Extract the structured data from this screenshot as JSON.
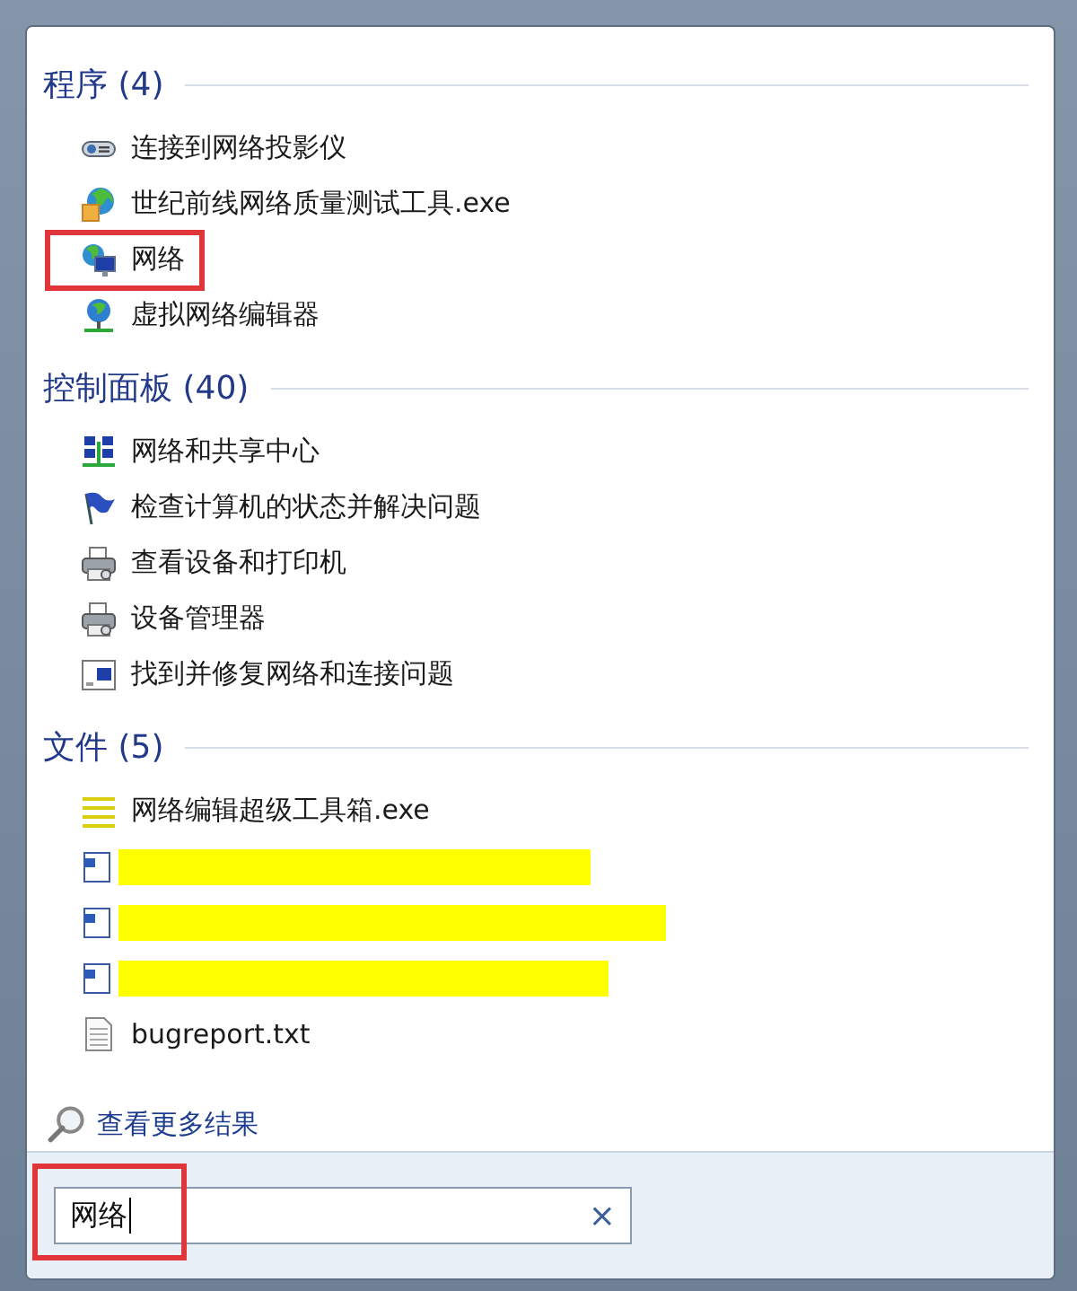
{
  "sections": [
    {
      "title": "程序 (4)",
      "items": [
        {
          "kind": "entry",
          "label": "连接到网络投影仪",
          "marked": false
        },
        {
          "kind": "entry",
          "label": "世纪前线网络质量测试工具.exe",
          "marked": false
        },
        {
          "kind": "entry",
          "label": "网络",
          "marked": true
        },
        {
          "kind": "entry",
          "label": "虚拟网络编辑器",
          "marked": false
        }
      ]
    },
    {
      "title": "控制面板 (40)",
      "items": [
        {
          "kind": "entry",
          "label": "网络和共享中心",
          "marked": false
        },
        {
          "kind": "entry",
          "label": "检查计算机的状态并解决问题",
          "marked": false
        },
        {
          "kind": "entry",
          "label": "查看设备和打印机",
          "marked": false
        },
        {
          "kind": "entry",
          "label": "设备管理器",
          "marked": false
        },
        {
          "kind": "entry",
          "label": "找到并修复网络和连接问题",
          "marked": false
        }
      ]
    },
    {
      "title": "文件 (5)",
      "items": [
        {
          "kind": "entry",
          "label": "网络编辑超级工具箱.exe",
          "marked": false
        },
        {
          "kind": "redacted",
          "marked": false
        },
        {
          "kind": "redacted",
          "marked": false
        },
        {
          "kind": "redacted",
          "marked": false
        },
        {
          "kind": "entry",
          "label": "bugreport.txt",
          "marked": false
        }
      ]
    }
  ],
  "more_results": "查看更多结果",
  "search": {
    "value": "网络",
    "marked": true,
    "clear": "×"
  }
}
